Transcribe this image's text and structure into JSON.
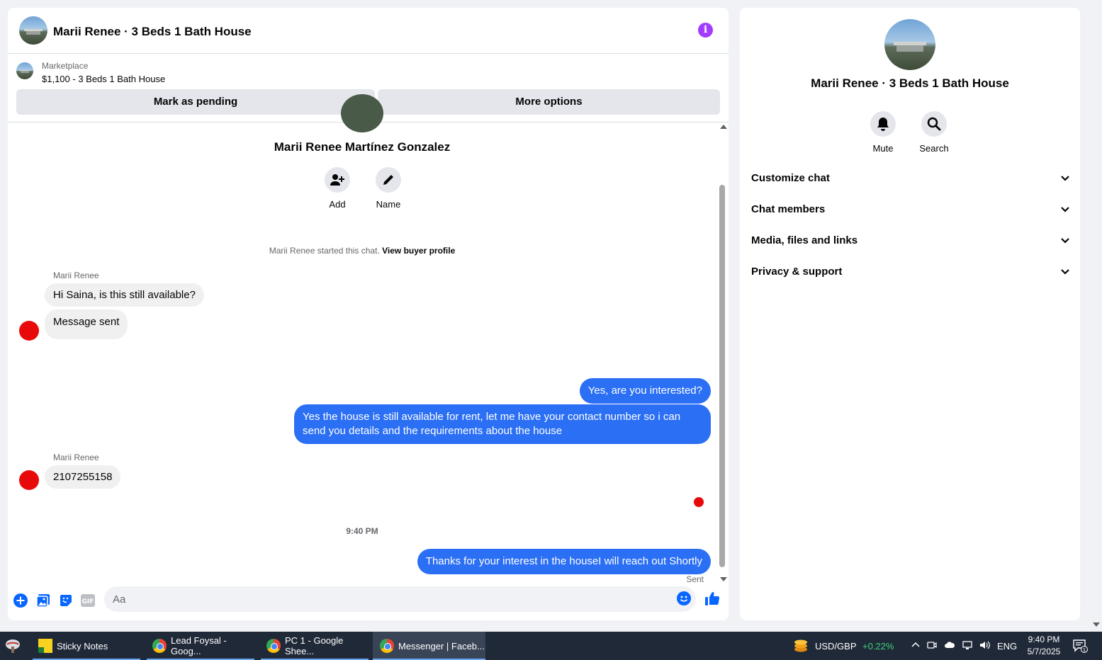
{
  "chat": {
    "title": "Marii Renee · 3 Beds 1 Bath House",
    "info_icon": "info-icon",
    "listing": {
      "source": "Marketplace",
      "price_title": "$1,100 - 3 Beds 1 Bath House",
      "mark_pending": "Mark as pending",
      "more_options": "More options"
    },
    "profile": {
      "name": "Marii Renee Martínez Gonzalez",
      "add_label": "Add",
      "name_label": "Name"
    },
    "started": {
      "text": "Marii Renee started this chat.",
      "link": "View buyer profile"
    },
    "messages": {
      "sender1": "Marii Renee",
      "in1": "Hi Saina, is this still available?",
      "in2": "Message sent",
      "out1": "Yes, are you interested?",
      "out2": "Yes the house is still available for rent, let me have your contact number so i can send you details and the requirements about the house",
      "sender2": "Marii Renee",
      "in3": "2107255158",
      "time": "9:40 PM",
      "out3": "Thanks for your interest in the houseI will reach out Shortly",
      "status": "Sent"
    },
    "composer": {
      "placeholder": "Aa"
    }
  },
  "info": {
    "title": "Marii Renee · 3 Beds 1 Bath House",
    "mute": "Mute",
    "search": "Search",
    "sections": [
      "Customize chat",
      "Chat members",
      "Media, files and links",
      "Privacy & support"
    ]
  },
  "taskbar": {
    "items": [
      "Sticky Notes",
      "Lead Foysal - Goog...",
      "PC 1 - Google Shee...",
      "Messenger | Faceb..."
    ],
    "fx_pair": "USD/GBP",
    "fx_change": "+0.22%",
    "language": "ENG",
    "time": "9:40 PM",
    "date": "5/7/2025",
    "notification_count": "1"
  },
  "colors": {
    "accent_blue": "#2b6ff5",
    "red_avatar": "#e80a0a",
    "info_purple": "#a33bff"
  }
}
